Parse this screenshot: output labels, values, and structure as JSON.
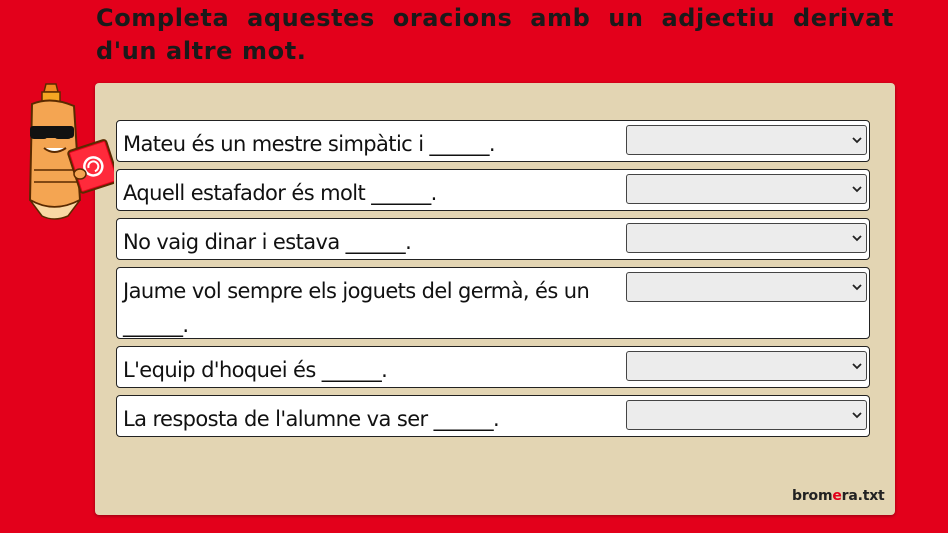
{
  "header": {
    "instruction": "Completa aquestes oracions amb un adjectiu derivat d'un altre mot."
  },
  "exercise": {
    "items": [
      {
        "sentence": "Mateu és un mestre simpàtic i ______.",
        "selected": ""
      },
      {
        "sentence": "Aquell estafador és molt ______.",
        "selected": ""
      },
      {
        "sentence": "No vaig dinar i estava ______.",
        "selected": ""
      },
      {
        "sentence": "Jaume vol sempre els joguets del germà, és un ______.",
        "selected": ""
      },
      {
        "sentence": "L'equip d'hoquei és ______.",
        "selected": ""
      },
      {
        "sentence": "La resposta de l'alumne va ser ______.",
        "selected": ""
      }
    ]
  },
  "icons": {
    "mascot": "pencil-mascot-icon",
    "dropdown": "chevron-down-icon"
  },
  "footer": {
    "brand_prefix": "brom",
    "brand_accent": "e",
    "brand_suffix": "ra.txt"
  },
  "colors": {
    "background": "#e3001b",
    "panel": "#e3d5b3",
    "select_bg": "#ececec",
    "brand_accent": "#e3001b"
  }
}
